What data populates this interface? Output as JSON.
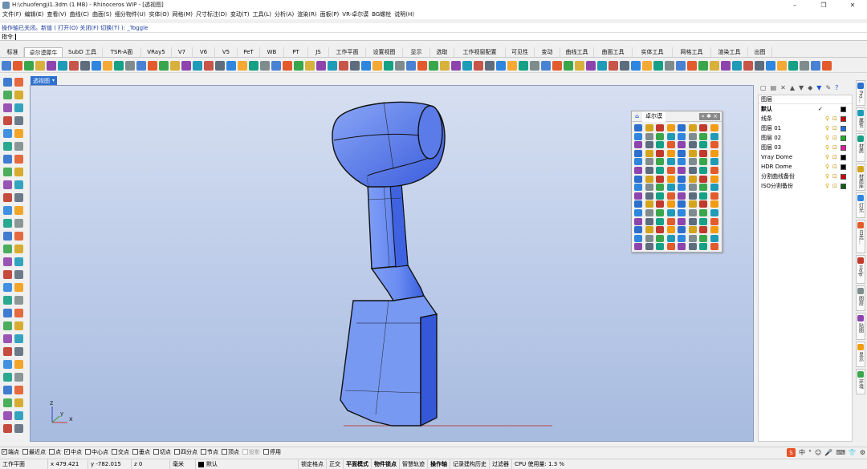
{
  "window": {
    "title": "H:\\chuofengji1.3dm (1 MB) - Rhinoceros WIP - [透视图]",
    "minimize": "–",
    "restore": "❐",
    "close": "✕"
  },
  "menu": [
    "文件(F)",
    "编辑(E)",
    "查看(V)",
    "曲线(C)",
    "曲面(S)",
    "细分物件(U)",
    "实体(O)",
    "网格(M)",
    "尺寸标注(D)",
    "变动(T)",
    "工具(L)",
    "分析(A)",
    "渲染(R)",
    "面板(P)",
    "VR-卓尔谟",
    "BG螺栓",
    "说明(H)"
  ],
  "command": {
    "history": "操作轴已关闭。新值 ( 打开(O) 关闭(F) 切换(T) ): _Toggle",
    "prompt": "指令:"
  },
  "tabs": [
    "标准",
    "卓尔谟犀牛",
    "SubD 工具",
    "TSR-A面",
    "VRay5",
    "V7",
    "V6",
    "V5",
    "PeT",
    "WB",
    "PT",
    "JS",
    "工作平面",
    "设置视图",
    "显示",
    "选取",
    "工作视窗配置",
    "可见性",
    "变动",
    "曲线工具",
    "曲面工具",
    "实体工具",
    "网格工具",
    "渲染工具",
    "出图"
  ],
  "active_tab_index": 1,
  "viewport": {
    "label": "透视图",
    "axis": {
      "x": "x",
      "y": "y",
      "z": "z"
    }
  },
  "floating_panel": {
    "tab_active": "卓尔谟",
    "tab_other": "",
    "controls": "« ✱ ×"
  },
  "layers": {
    "toolbar_icons": [
      "new-layer-icon",
      "new-sublayer-icon",
      "delete-icon",
      "move-up-icon",
      "move-down-icon",
      "move-to-parent-icon",
      "filter-icon",
      "tools-icon",
      "help-icon"
    ],
    "header": "图层",
    "items": [
      {
        "name": "默认",
        "current": true,
        "color": "#000000"
      },
      {
        "name": "线条",
        "current": false,
        "color": "#cc0000"
      },
      {
        "name": "图层 01",
        "current": false,
        "color": "#1a6fe0"
      },
      {
        "name": "图层 02",
        "current": false,
        "color": "#19b026"
      },
      {
        "name": "图层 03",
        "current": false,
        "color": "#e0189e"
      },
      {
        "name": "Vray Dome",
        "current": false,
        "color": "#000000"
      },
      {
        "name": "HDR Dome",
        "current": false,
        "color": "#000000"
      },
      {
        "name": "分割曲线备份",
        "current": false,
        "color": "#cc0000"
      },
      {
        "name": "ISO分割备份",
        "current": false,
        "color": "#0b5e14"
      }
    ]
  },
  "side_tabs": [
    "Pro...",
    "属性",
    "材质",
    "材质库",
    "灯光",
    "日志...",
    "Help",
    "图层",
    "贴图",
    "显示",
    "环境"
  ],
  "osnaps": [
    {
      "label": "端点",
      "checked": true,
      "enabled": true
    },
    {
      "label": "最近点",
      "checked": false,
      "enabled": true
    },
    {
      "label": "点",
      "checked": false,
      "enabled": true
    },
    {
      "label": "中点",
      "checked": true,
      "enabled": true
    },
    {
      "label": "中心点",
      "checked": false,
      "enabled": true
    },
    {
      "label": "交点",
      "checked": false,
      "enabled": true
    },
    {
      "label": "垂点",
      "checked": false,
      "enabled": true
    },
    {
      "label": "切点",
      "checked": false,
      "enabled": true
    },
    {
      "label": "四分点",
      "checked": false,
      "enabled": true
    },
    {
      "label": "节点",
      "checked": false,
      "enabled": true
    },
    {
      "label": "顶点",
      "checked": false,
      "enabled": true
    },
    {
      "label": "投影",
      "checked": false,
      "enabled": false
    },
    {
      "label": "停用",
      "checked": false,
      "enabled": true
    }
  ],
  "status": {
    "cplane": "工作平面",
    "x": "x 479.421",
    "y": "y -782.015",
    "z": "z 0",
    "units": "毫米",
    "layer": "默认",
    "toggles": [
      {
        "label": "锁定格点",
        "bold": false
      },
      {
        "label": "正交",
        "bold": false
      },
      {
        "label": "平面模式",
        "bold": true
      },
      {
        "label": "物件锁点",
        "bold": true
      },
      {
        "label": "智慧轨迹",
        "bold": false
      },
      {
        "label": "操作轴",
        "bold": true
      },
      {
        "label": "记录建构历史",
        "bold": false
      },
      {
        "label": "过滤器",
        "bold": false
      }
    ],
    "cpu": "CPU 使用量: 1.3 %",
    "tray_logo": "S",
    "tray_icons": [
      "中",
      "°",
      "☺",
      "🎤",
      "⌨",
      "👕",
      "⚙"
    ]
  }
}
